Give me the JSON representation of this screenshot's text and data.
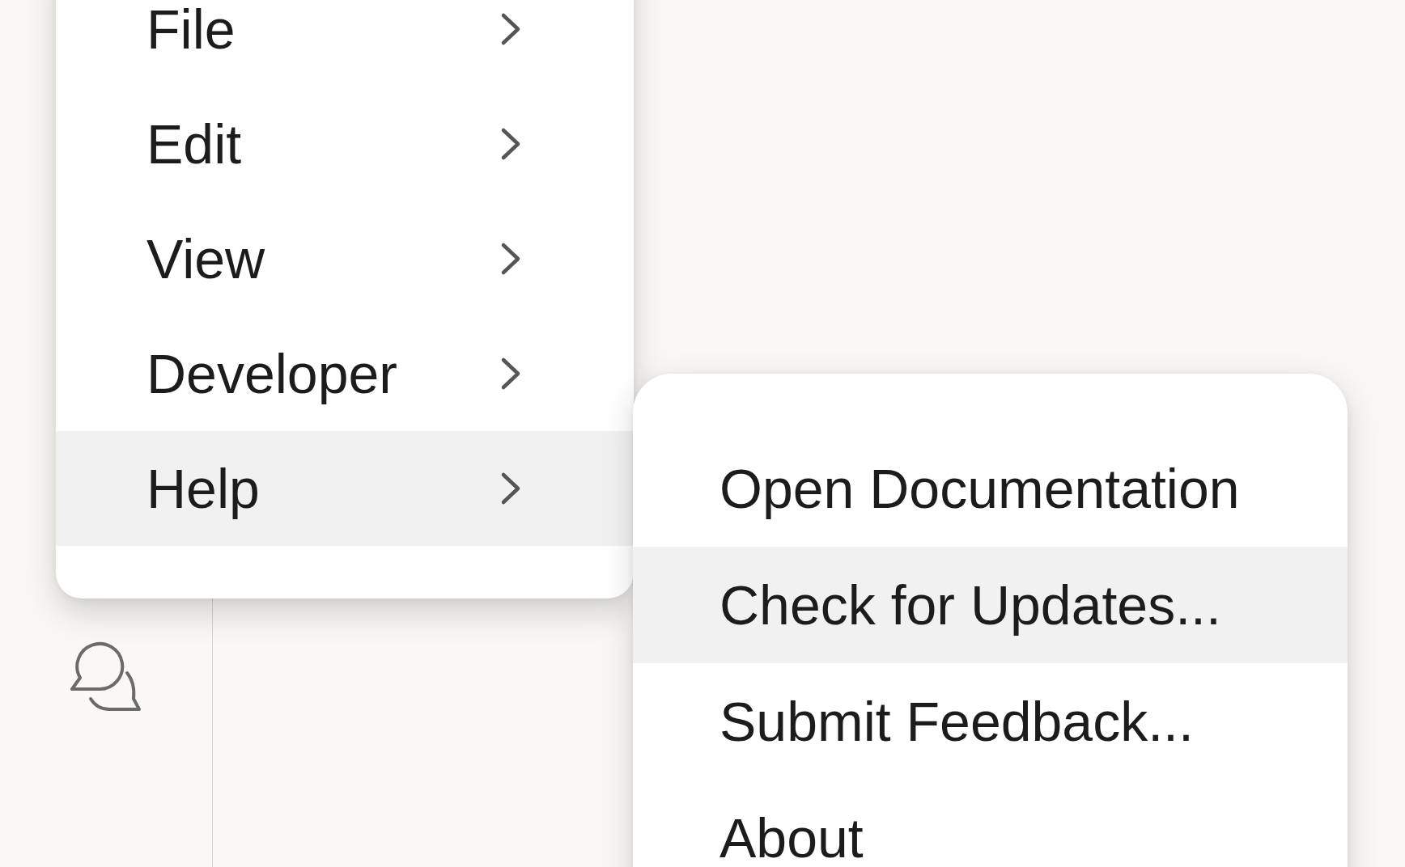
{
  "menu": {
    "items": [
      {
        "label": "File",
        "has_submenu": true,
        "selected": false
      },
      {
        "label": "Edit",
        "has_submenu": true,
        "selected": false
      },
      {
        "label": "View",
        "has_submenu": true,
        "selected": false
      },
      {
        "label": "Developer",
        "has_submenu": true,
        "selected": false
      },
      {
        "label": "Help",
        "has_submenu": true,
        "selected": true
      }
    ]
  },
  "submenu": {
    "items": [
      {
        "label": "Open Documentation",
        "selected": false
      },
      {
        "label": "Check for Updates...",
        "selected": true
      },
      {
        "label": "Submit Feedback...",
        "selected": false
      },
      {
        "label": "About",
        "selected": false
      }
    ]
  }
}
